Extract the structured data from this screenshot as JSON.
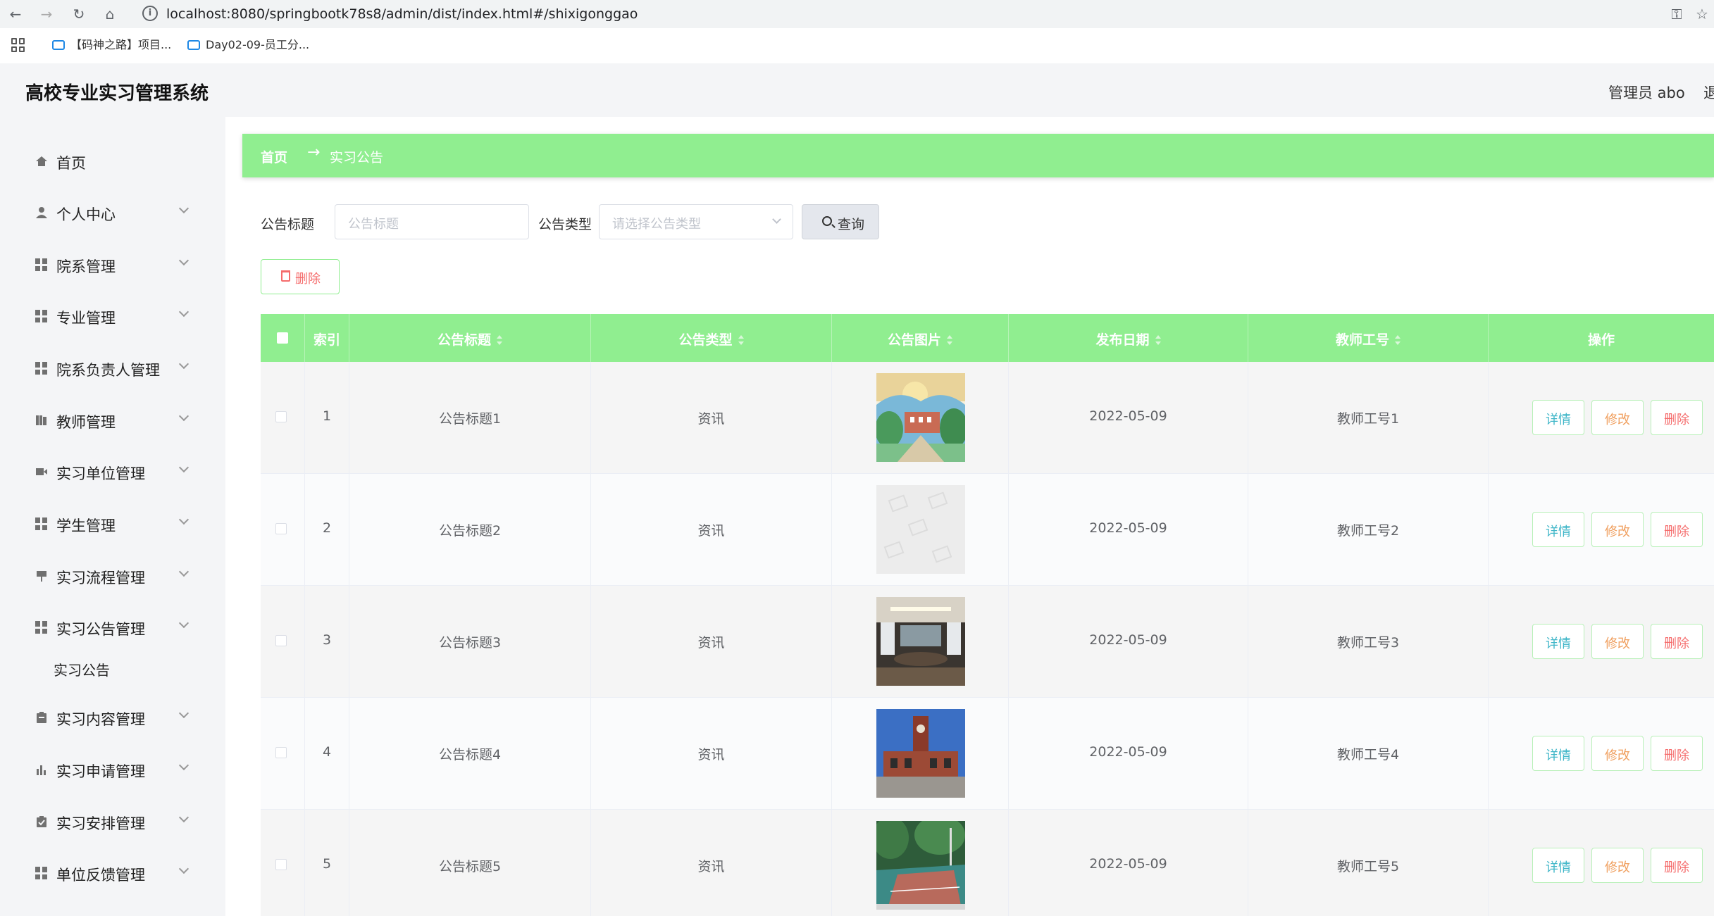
{
  "browser": {
    "url": "localhost:8080/springbootk78s8/admin/dist/index.html#/shixigonggao",
    "bookmarks": [
      "【码神之路】项目...",
      "Day02-09-员工分..."
    ]
  },
  "header": {
    "title": "高校专业实习管理系统",
    "user": "管理员 abo",
    "logout": "退出登录"
  },
  "sidebar": {
    "items": [
      {
        "label": "首页",
        "icon": "home-icon"
      },
      {
        "label": "个人中心",
        "icon": "user-icon"
      },
      {
        "label": "院系管理",
        "icon": "grid-icon"
      },
      {
        "label": "专业管理",
        "icon": "grid-icon"
      },
      {
        "label": "院系负责人管理",
        "icon": "grid-icon"
      },
      {
        "label": "教师管理",
        "icon": "book-icon"
      },
      {
        "label": "实习单位管理",
        "icon": "video-icon"
      },
      {
        "label": "学生管理",
        "icon": "grid-icon"
      },
      {
        "label": "实习流程管理",
        "icon": "flag-icon"
      },
      {
        "label": "实习公告管理",
        "icon": "grid-icon"
      },
      {
        "label": "实习内容管理",
        "icon": "clipboard-icon"
      },
      {
        "label": "实习申请管理",
        "icon": "bar-chart-icon"
      },
      {
        "label": "实习安排管理",
        "icon": "check-clipboard-icon"
      },
      {
        "label": "单位反馈管理",
        "icon": "grid-icon"
      }
    ],
    "sub_item": "实习公告"
  },
  "breadcrumb": {
    "home": "首页",
    "arrow": "→",
    "current": "实习公告"
  },
  "search": {
    "title_label": "公告标题",
    "title_placeholder": "公告标题",
    "type_label": "公告类型",
    "type_placeholder": "请选择公告类型",
    "button": "查询"
  },
  "batch_delete": "删除",
  "table": {
    "headers": {
      "index": "索引",
      "title": "公告标题",
      "type": "公告类型",
      "image": "公告图片",
      "date": "发布日期",
      "teacher_id": "教师工号",
      "actions": "操作"
    },
    "rows": [
      {
        "index": "1",
        "title": "公告标题1",
        "type": "资讯",
        "image": "campus-painting",
        "date": "2022-05-09",
        "teacher_id": "教师工号1"
      },
      {
        "index": "2",
        "title": "公告标题2",
        "type": "资讯",
        "image": "placeholder",
        "date": "2022-05-09",
        "teacher_id": "教师工号2"
      },
      {
        "index": "3",
        "title": "公告标题3",
        "type": "资讯",
        "image": "meeting-room",
        "date": "2022-05-09",
        "teacher_id": "教师工号3"
      },
      {
        "index": "4",
        "title": "公告标题4",
        "type": "资讯",
        "image": "clock-tower",
        "date": "2022-05-09",
        "teacher_id": "教师工号4"
      },
      {
        "index": "5",
        "title": "公告标题5",
        "type": "资讯",
        "image": "sports-court",
        "date": "2022-05-09",
        "teacher_id": "教师工号5"
      }
    ],
    "actions": {
      "detail": "详情",
      "edit": "修改",
      "delete": "删除"
    }
  },
  "colors": {
    "accent_green": "#90ee90",
    "detail_text": "#3fb6c8",
    "edit_text": "#f0a060",
    "delete_text": "#f56c6c"
  }
}
